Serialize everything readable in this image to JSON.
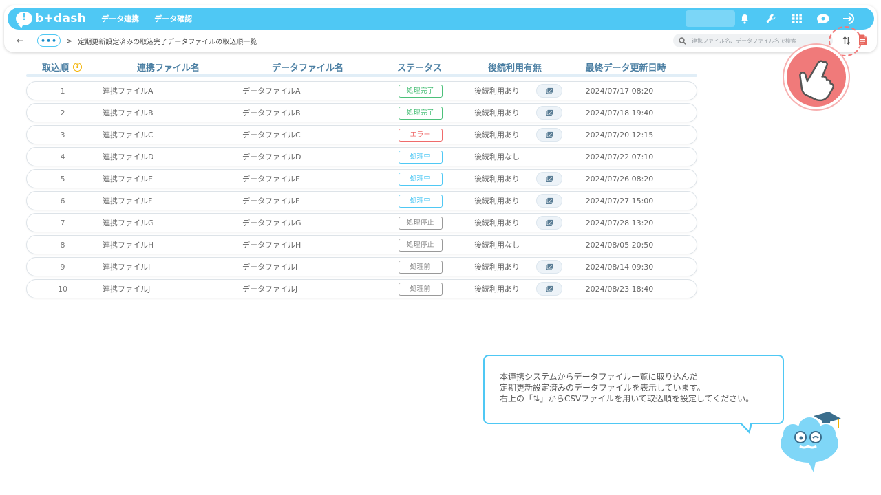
{
  "app": {
    "logo": "b+dash"
  },
  "nav": {
    "items": [
      "データ連携",
      "データ確認"
    ]
  },
  "breadcrumb": {
    "back": "←",
    "more": "•••",
    "separator": ">",
    "current": "定期更新設定済みの取込完了データファイルの取込順一覧"
  },
  "search": {
    "placeholder": "連携ファイル名、データファイル名で検索"
  },
  "table": {
    "headers": {
      "order": "取込順",
      "link_file": "連携ファイル名",
      "data_file": "データファイル名",
      "status": "ステータス",
      "usage": "後続利用有無",
      "updated": "最終データ更新日時"
    },
    "help_mark": "?",
    "rows": [
      {
        "order": "1",
        "link_file": "連携ファイルA",
        "data_file": "データファイルA",
        "status": "処理完了",
        "status_type": "done",
        "usage": "後続利用あり",
        "has_detail": true,
        "updated": "2024/07/17 08:20"
      },
      {
        "order": "2",
        "link_file": "連携ファイルB",
        "data_file": "データファイルB",
        "status": "処理完了",
        "status_type": "done",
        "usage": "後続利用あり",
        "has_detail": true,
        "updated": "2024/07/18 19:40"
      },
      {
        "order": "3",
        "link_file": "連携ファイルC",
        "data_file": "データファイルC",
        "status": "エラー",
        "status_type": "error",
        "usage": "後続利用あり",
        "has_detail": true,
        "updated": "2024/07/20 12:15"
      },
      {
        "order": "4",
        "link_file": "連携ファイルD",
        "data_file": "データファイルD",
        "status": "処理中",
        "status_type": "proc",
        "usage": "後続利用なし",
        "has_detail": false,
        "updated": "2024/07/22 07:10"
      },
      {
        "order": "5",
        "link_file": "連携ファイルE",
        "data_file": "データファイルE",
        "status": "処理中",
        "status_type": "proc",
        "usage": "後続利用あり",
        "has_detail": true,
        "updated": "2024/07/26 08:20"
      },
      {
        "order": "6",
        "link_file": "連携ファイルF",
        "data_file": "データファイルF",
        "status": "処理中",
        "status_type": "proc",
        "usage": "後続利用あり",
        "has_detail": true,
        "updated": "2024/07/27 15:00"
      },
      {
        "order": "7",
        "link_file": "連携ファイルG",
        "data_file": "データファイルG",
        "status": "処理停止",
        "status_type": "stop",
        "usage": "後続利用あり",
        "has_detail": true,
        "updated": "2024/07/28 13:20"
      },
      {
        "order": "8",
        "link_file": "連携ファイルH",
        "data_file": "データファイルH",
        "status": "処理停止",
        "status_type": "stop",
        "usage": "後続利用なし",
        "has_detail": false,
        "updated": "2024/08/05 20:50"
      },
      {
        "order": "9",
        "link_file": "連携ファイルI",
        "data_file": "データファイルI",
        "status": "処理前",
        "status_type": "pre",
        "usage": "後続利用あり",
        "has_detail": true,
        "updated": "2024/08/14 09:30"
      },
      {
        "order": "10",
        "link_file": "連携ファイルJ",
        "data_file": "データファイルJ",
        "status": "処理前",
        "status_type": "pre",
        "usage": "後続利用あり",
        "has_detail": true,
        "updated": "2024/08/23 18:40"
      }
    ]
  },
  "tooltip": {
    "line1": "本連携システムからデータファイル一覧に取り込んだ",
    "line2": "定期更新設定済みのデータファイルを表示しています。",
    "line3": "右上の「⇅」からCSVファイルを用いて取込順を設定してください。"
  },
  "colors": {
    "brand": "#4fc8f4",
    "done": "#4cc07a",
    "error": "#ef6b6b",
    "highlight": "#f07a7a",
    "header_text": "#4b7fa3"
  },
  "icons": [
    "bell-icon",
    "wrench-icon",
    "grid-icon",
    "chat-icon",
    "logout-icon",
    "search-icon",
    "sort-icon",
    "csv-file-icon",
    "hand-pointer-icon",
    "detail-icon"
  ]
}
